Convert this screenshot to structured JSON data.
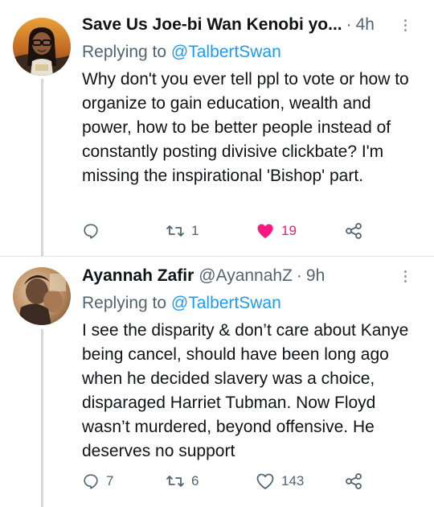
{
  "tweets": [
    {
      "name": "Save Us Joe-bi Wan Kenobi yo...",
      "handle": "",
      "separator": "·",
      "time": "4h",
      "replying_label": "Replying to",
      "replying_to": "@TalbertSwan",
      "text": "Why don't you ever tell ppl to vote or how to organize to gain education, wealth and power, how to be better people instead of constantly posting divisive clickbate? I'm missing the inspirational 'Bishop' part.",
      "reply_count": "",
      "retweet_count": "1",
      "like_count": "19",
      "liked": true,
      "icons": [
        "reply-icon",
        "retweet-icon",
        "heart-filled-icon",
        "share-icon"
      ]
    },
    {
      "name": "Ayannah Zafir",
      "handle": "@AyannahZ",
      "separator": "·",
      "time": "9h",
      "replying_label": "Replying to",
      "replying_to": "@TalbertSwan",
      "text": "I see the disparity & don’t care about Kanye being cancel, should have been long ago when he decided slavery was a choice, disparaged Harriet Tubman. Now Floyd wasn’t murdered, beyond offensive. He deserves no support",
      "reply_count": "7",
      "retweet_count": "6",
      "like_count": "143",
      "liked": false,
      "icons": [
        "reply-icon",
        "retweet-icon",
        "heart-outline-icon",
        "share-icon"
      ]
    }
  ],
  "colors": {
    "accent": "#1d9bf0",
    "like": "#f91880",
    "muted": "#536471",
    "text": "#0f1419"
  }
}
